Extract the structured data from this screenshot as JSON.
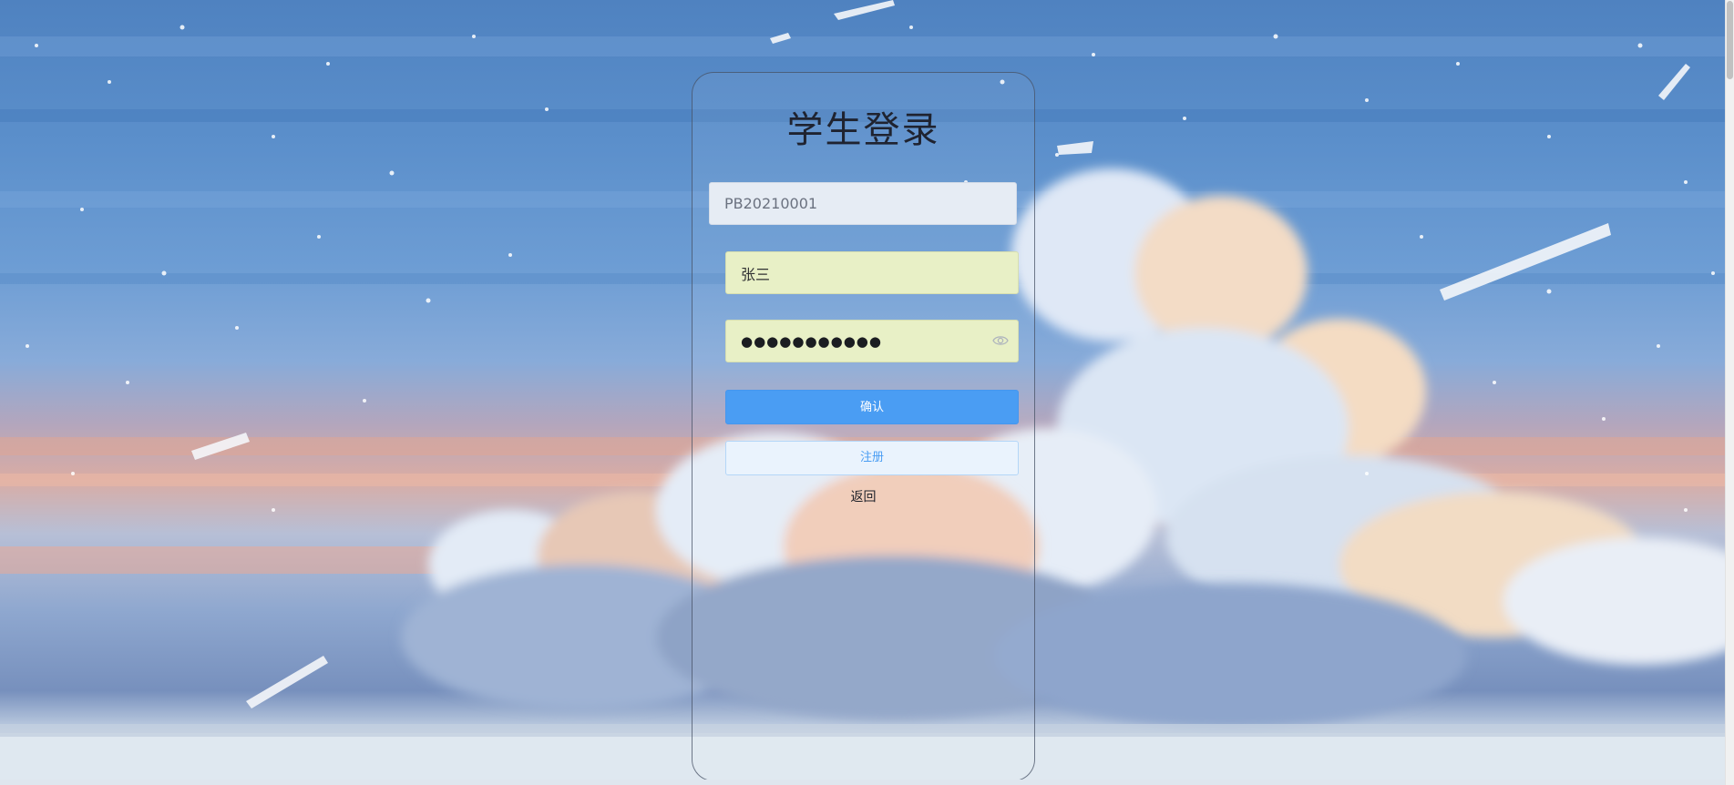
{
  "login": {
    "title": "学生登录",
    "student_id_value": "PB20210001",
    "name_value": "张三",
    "password_mask": "●●●●●●●●●●●",
    "password_icon": "eye-icon",
    "confirm_label": "确认",
    "register_label": "注册",
    "back_label": "返回"
  },
  "colors": {
    "primary": "#4a9df3",
    "autofill": "#e8f0c6",
    "title": "#1f2330"
  }
}
